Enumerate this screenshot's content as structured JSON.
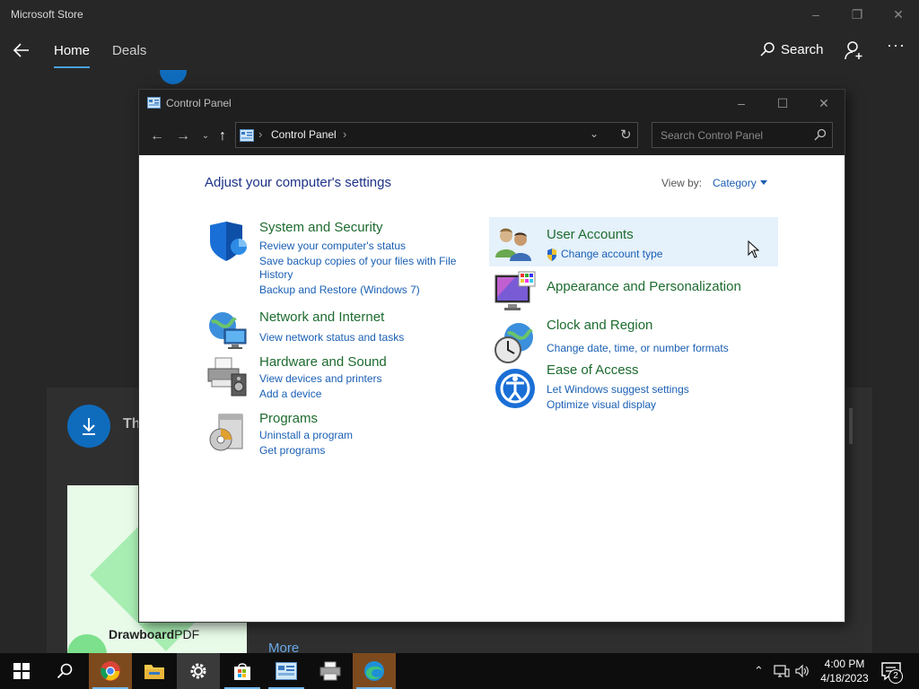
{
  "store": {
    "title": "Microsoft Store",
    "tabs": [
      {
        "label": "Home"
      },
      {
        "label": "Deals"
      }
    ],
    "search_label": "Search",
    "more_label": "···",
    "section_title_partial": "Th",
    "card_label_bold": "Drawboard",
    "card_label_light": "PDF",
    "more_link": "More"
  },
  "control_panel": {
    "title": "Control Panel",
    "breadcrumb": [
      "Control Panel"
    ],
    "search_placeholder": "Search Control Panel",
    "heading": "Adjust your computer's settings",
    "view_by_label": "View by:",
    "view_by_value": "Category",
    "categories_left": [
      {
        "title": "System and Security",
        "icon": "shield-icon",
        "links": [
          "Review your computer's status",
          "Save backup copies of your files with File",
          "History",
          "Backup and Restore (Windows 7)"
        ]
      },
      {
        "title": "Network and Internet",
        "icon": "globe-network-icon",
        "links": [
          "View network status and tasks"
        ]
      },
      {
        "title": "Hardware and Sound",
        "icon": "printer-speaker-icon",
        "links": [
          "View devices and printers",
          "Add a device"
        ]
      },
      {
        "title": "Programs",
        "icon": "programs-disc-icon",
        "links": [
          "Uninstall a program",
          "Get programs"
        ]
      }
    ],
    "categories_right": [
      {
        "title": "User Accounts",
        "icon": "users-icon",
        "links": [
          "Change account type"
        ]
      },
      {
        "title": "Appearance and Personalization",
        "icon": "monitor-palette-icon",
        "links": []
      },
      {
        "title": "Clock and Region",
        "icon": "clock-globe-icon",
        "links": [
          "Change date, time, or number formats"
        ]
      },
      {
        "title": "Ease of Access",
        "icon": "ease-of-access-icon",
        "links": [
          "Let Windows suggest settings",
          "Optimize visual display"
        ]
      }
    ]
  },
  "taskbar": {
    "apps": [
      "start-icon",
      "search-icon",
      "chrome-icon",
      "file-explorer-icon",
      "settings-icon",
      "store-icon",
      "control-panel-icon",
      "printer-icon",
      "edge-icon"
    ],
    "time": "4:00 PM",
    "date": "4/18/2023",
    "notification_count": "2"
  },
  "colors": {
    "accent_link": "#1a5fb4",
    "category_title": "#1d6b2f",
    "heading": "#1e3287",
    "hover_highlight": "#e5f1fb",
    "taskbar": "#0d0d0d"
  }
}
